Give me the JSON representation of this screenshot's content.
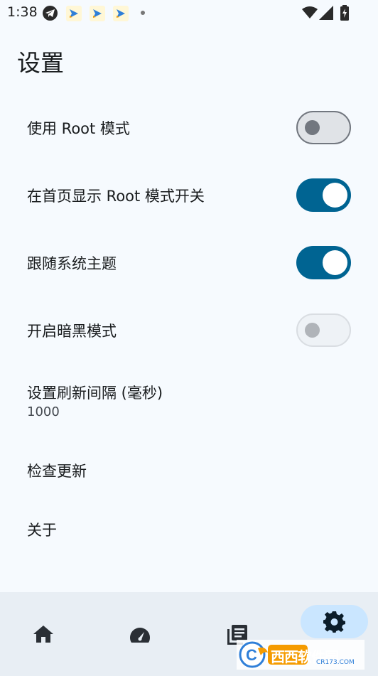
{
  "status_bar": {
    "time": "1:38",
    "icons": [
      "telegram-icon",
      "arrow-app-icon",
      "arrow-app-icon",
      "arrow-app-icon",
      "notification-dot",
      "wifi-icon",
      "signal-icon",
      "battery-charging-icon"
    ]
  },
  "page": {
    "title": "设置"
  },
  "settings": [
    {
      "label": "使用 Root 模式",
      "type": "toggle",
      "state": "off"
    },
    {
      "label": "在首页显示 Root 模式开关",
      "type": "toggle",
      "state": "on"
    },
    {
      "label": "跟随系统主题",
      "type": "toggle",
      "state": "on"
    },
    {
      "label": "开启暗黑模式",
      "type": "toggle",
      "state": "off-disabled"
    },
    {
      "label": "设置刷新间隔 (毫秒)",
      "type": "value",
      "value": "1000"
    },
    {
      "label": "检查更新",
      "type": "action"
    },
    {
      "label": "关于",
      "type": "action"
    }
  ],
  "bottom_nav": {
    "items": [
      {
        "icon": "home-icon",
        "selected": false
      },
      {
        "icon": "speedometer-icon",
        "selected": false
      },
      {
        "icon": "library-icon",
        "selected": false
      },
      {
        "icon": "gear-icon",
        "selected": true
      }
    ]
  },
  "watermark": {
    "text": "西西软件园",
    "subtext": "CR173.COM"
  },
  "colors": {
    "background": "#f6fafe",
    "accent": "#006492",
    "nav_background": "#e8eef4",
    "nav_pill": "#cae6ff"
  }
}
